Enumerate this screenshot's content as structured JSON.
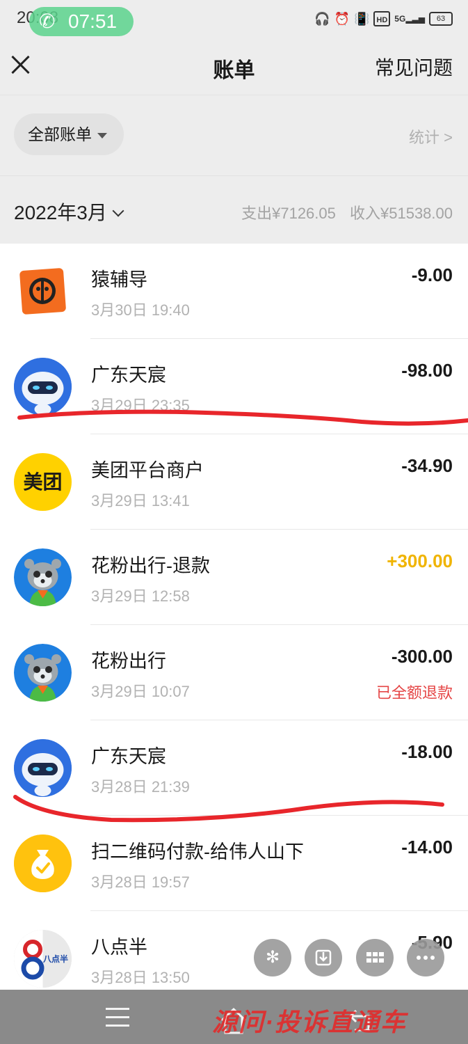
{
  "status_bar": {
    "time": "20:08",
    "call_timer": "07:51",
    "network": "5G",
    "hd": "HD",
    "battery": "63"
  },
  "nav": {
    "title": "账单",
    "faq_label": "常见问题"
  },
  "filter": {
    "label": "全部账单",
    "stats_label": "统计 >"
  },
  "month": {
    "label": "2022年3月",
    "expense": "支出¥7126.05",
    "income": "收入¥51538.00"
  },
  "transactions": [
    {
      "name": "猿辅导",
      "time": "3月30日 19:40",
      "amount": "-9.00",
      "note": "",
      "icon": "monkey-logo-icon"
    },
    {
      "name": "广东天宸",
      "time": "3月29日 23:35",
      "amount": "-98.00",
      "note": "",
      "icon": "robot-avatar-icon"
    },
    {
      "name": "美团平台商户",
      "time": "3月29日 13:41",
      "amount": "-34.90",
      "note": "",
      "icon": "meituan-logo-icon",
      "logo_text": "美团"
    },
    {
      "name": "花粉出行-退款",
      "time": "3月29日 12:58",
      "amount": "+300.00",
      "note": "",
      "icon": "raccoon-avatar-icon"
    },
    {
      "name": "花粉出行",
      "time": "3月29日 10:07",
      "amount": "-300.00",
      "note": "已全额退款",
      "icon": "raccoon-avatar-icon"
    },
    {
      "name": "广东天宸",
      "time": "3月28日 21:39",
      "amount": "-18.00",
      "note": "",
      "icon": "robot-avatar-icon"
    },
    {
      "name": "扫二维码付款-给伟人山下",
      "time": "3月28日 19:57",
      "amount": "-14.00",
      "note": "",
      "icon": "money-bag-icon"
    },
    {
      "name": "八点半",
      "time": "3月28日 13:50",
      "amount": "-5.90",
      "note": "",
      "icon": "badianban-logo-icon",
      "logo_text": "八点半"
    }
  ],
  "colors": {
    "income": "#f0b400",
    "refund_note": "#e54545",
    "annotation": "#e8262b"
  },
  "toolbar_icons": [
    "sparkle-icon",
    "download-icon",
    "grid-icon",
    "more-icon"
  ],
  "watermark": "源问·投诉直通车"
}
